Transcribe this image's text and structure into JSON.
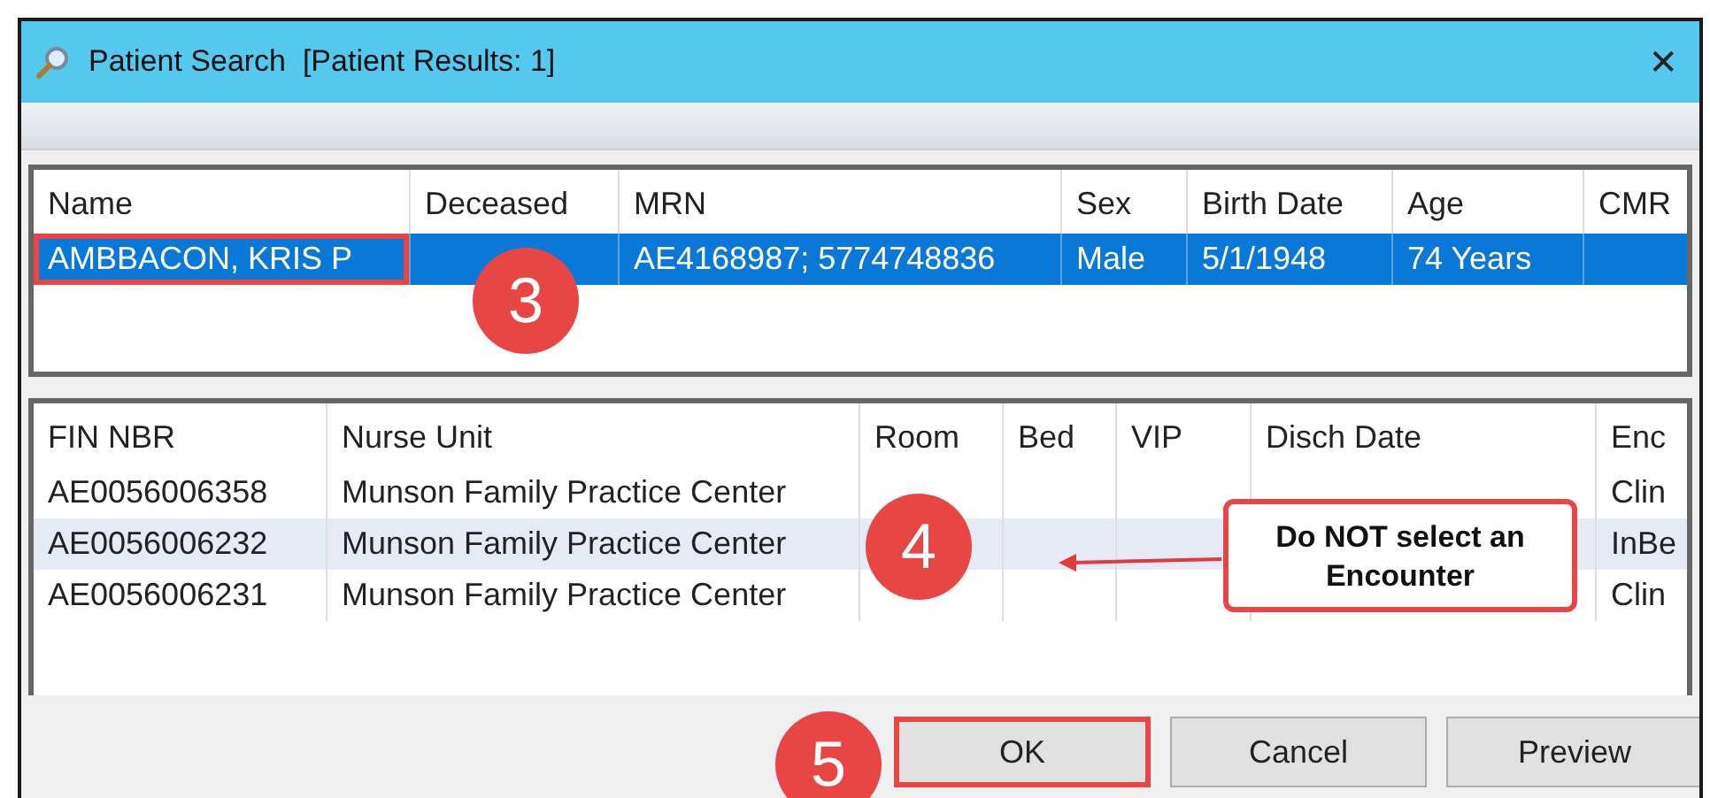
{
  "window": {
    "title": "Patient Search  [Patient Results: 1]",
    "close": "✕"
  },
  "patients": {
    "columns": [
      "Name",
      "Deceased",
      "MRN",
      "Sex",
      "Birth Date",
      "Age",
      "CMR"
    ],
    "rows": [
      {
        "cells": [
          "AMBBACON, KRIS P",
          "",
          "AE4168987; 5774748836",
          "Male",
          "5/1/1948",
          "74 Years",
          ""
        ],
        "selected": true
      }
    ]
  },
  "encounters": {
    "columns": [
      "FIN NBR",
      "Nurse Unit",
      "Room",
      "Bed",
      "VIP",
      "Disch Date",
      "Enc"
    ],
    "rows": [
      {
        "cells": [
          "AE0056006358",
          "Munson Family Practice Center",
          "",
          "",
          "",
          "",
          "Clin"
        ],
        "highlighted": false
      },
      {
        "cells": [
          "AE0056006232",
          "Munson Family Practice Center",
          "",
          "",
          "",
          "",
          "InBe"
        ],
        "highlighted": true
      },
      {
        "cells": [
          "AE0056006231",
          "Munson Family Practice Center",
          "",
          "",
          "",
          "",
          "Clin"
        ],
        "highlighted": false
      }
    ]
  },
  "buttons": [
    {
      "label": "OK",
      "outlined": true
    },
    {
      "label": "Cancel",
      "outlined": false
    },
    {
      "label": "Preview",
      "outlined": false
    }
  ],
  "annotations": {
    "badges": [
      "3",
      "4",
      "5"
    ],
    "callout": "Do NOT select an Encounter"
  }
}
